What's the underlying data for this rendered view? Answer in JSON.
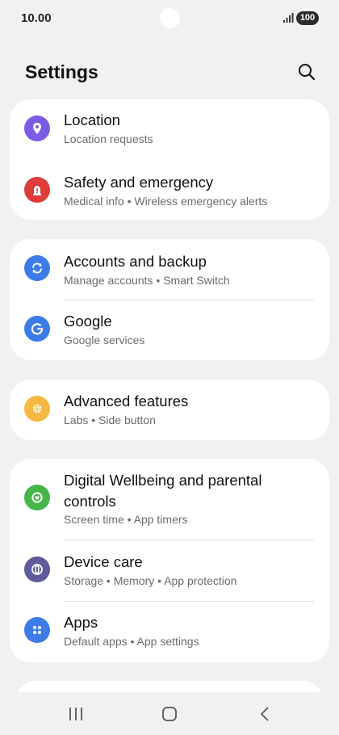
{
  "status_bar": {
    "time": "10.00",
    "battery": "100"
  },
  "header": {
    "title": "Settings"
  },
  "cards": [
    {
      "items": [
        {
          "title": "Location",
          "subtitle": "Location requests",
          "icon": "location-pin-icon",
          "color": "#7b5ce6"
        },
        {
          "title": "Safety and emergency",
          "subtitle": "Medical info  •  Wireless emergency alerts",
          "icon": "emergency-alert-icon",
          "color": "#de3b3b"
        }
      ]
    },
    {
      "items": [
        {
          "title": "Accounts and backup",
          "subtitle": "Manage accounts  •  Smart Switch",
          "icon": "sync-icon",
          "color": "#3d7be8"
        },
        {
          "title": "Google",
          "subtitle": "Google services",
          "icon": "google-icon",
          "color": "#3d7be8"
        }
      ]
    },
    {
      "items": [
        {
          "title": "Advanced features",
          "subtitle": "Labs  •  Side button",
          "icon": "gear-plus-icon",
          "color": "#f5b942"
        }
      ]
    },
    {
      "items": [
        {
          "title_line1": "Digital Wellbeing and parental",
          "title_line2": "controls",
          "subtitle": "Screen time  •  App timers",
          "icon": "wellbeing-icon",
          "color": "#45b649"
        },
        {
          "title": "Device care",
          "subtitle": "Storage  •  Memory  •  App protection",
          "icon": "device-care-icon",
          "color": "#5e5a9c"
        },
        {
          "title": "Apps",
          "subtitle": "Default apps  •  App settings",
          "icon": "apps-grid-icon",
          "color": "#3d7be8"
        }
      ]
    }
  ],
  "nav": {
    "recents": "recents-icon",
    "home": "home-icon",
    "back": "back-icon"
  }
}
